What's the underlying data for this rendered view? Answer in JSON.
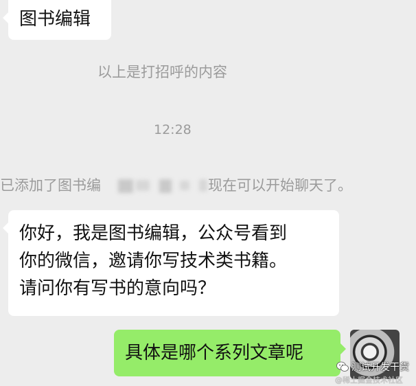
{
  "messages": {
    "editor_name": "图书编辑",
    "greeting_notice": "以上是打招呼的内容",
    "time": "12:28",
    "added_notice_prefix": "已添加了图书编",
    "added_notice_suffix": "现在可以开始聊天了。",
    "editor_message_line1": "你好，我是图书编辑，公众号看到",
    "editor_message_line2": "你的微信，邀请你写技术类书籍。",
    "editor_message_line3": "请问你有写书的意向吗？",
    "my_reply": "具体是哪个系列文章呢"
  },
  "watermark": {
    "title": "测试开发干货",
    "subtitle": "@稀土掘金技术社区",
    "icon": "wechat-icon"
  },
  "colors": {
    "background": "#ededed",
    "incoming_bubble": "#ffffff",
    "outgoing_bubble": "#95ec69",
    "system_text": "#9b9b9b"
  }
}
